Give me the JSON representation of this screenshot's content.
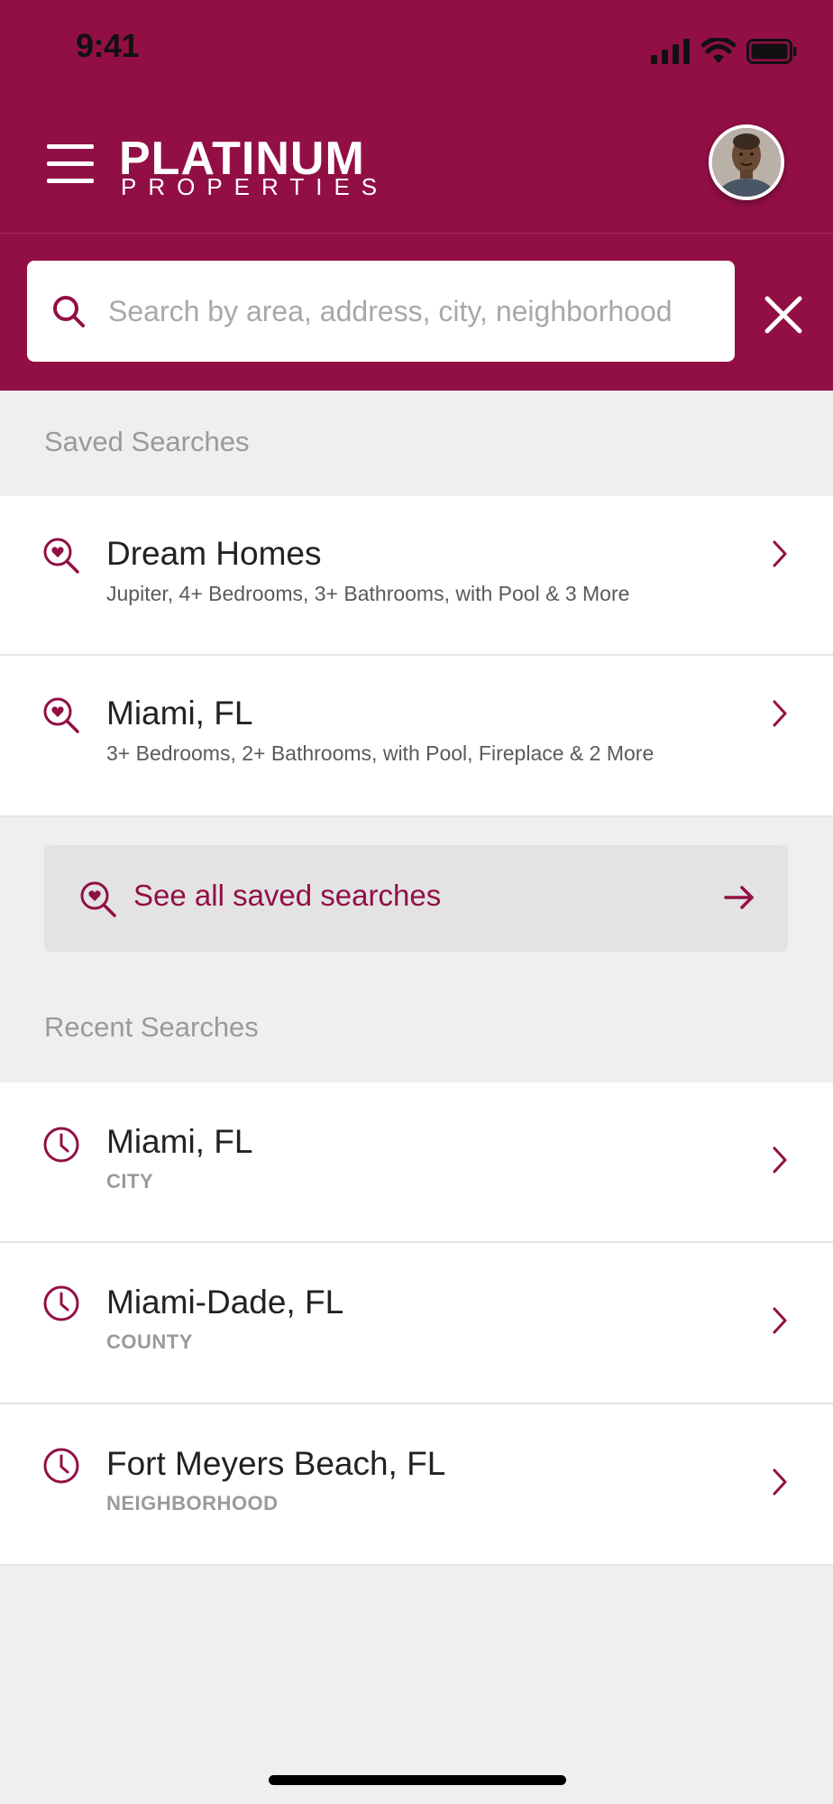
{
  "status_bar": {
    "time": "9:41",
    "icons": [
      "signal-icon",
      "wifi-icon",
      "battery-icon"
    ]
  },
  "header": {
    "menu_icon": "hamburger-menu-icon",
    "logo_line1": "PLATINUM",
    "logo_line2": "PROPERTIES",
    "avatar": "user-avatar",
    "brand_color": "#920f45"
  },
  "search": {
    "placeholder": "Search by area, address, city, neighborhood",
    "value": "",
    "clear_icon": "close-icon"
  },
  "saved_searches": {
    "title": "Saved Searches",
    "items": [
      {
        "title": "Dream Homes",
        "subtitle": "Jupiter, 4+ Bedrooms, 3+ Bathrooms, with Pool & 3 More"
      },
      {
        "title": "Miami, FL",
        "subtitle": "3+ Bedrooms, 2+ Bathrooms, with Pool, Fireplace & 2 More"
      }
    ],
    "see_all_label": "See all saved searches"
  },
  "recent_searches": {
    "title": "Recent Searches",
    "items": [
      {
        "title": "Miami, FL",
        "type": "CITY"
      },
      {
        "title": "Miami-Dade, FL",
        "type": "COUNTY"
      },
      {
        "title": "Fort Meyers Beach, FL",
        "type": "NEIGHBORHOOD"
      }
    ]
  }
}
